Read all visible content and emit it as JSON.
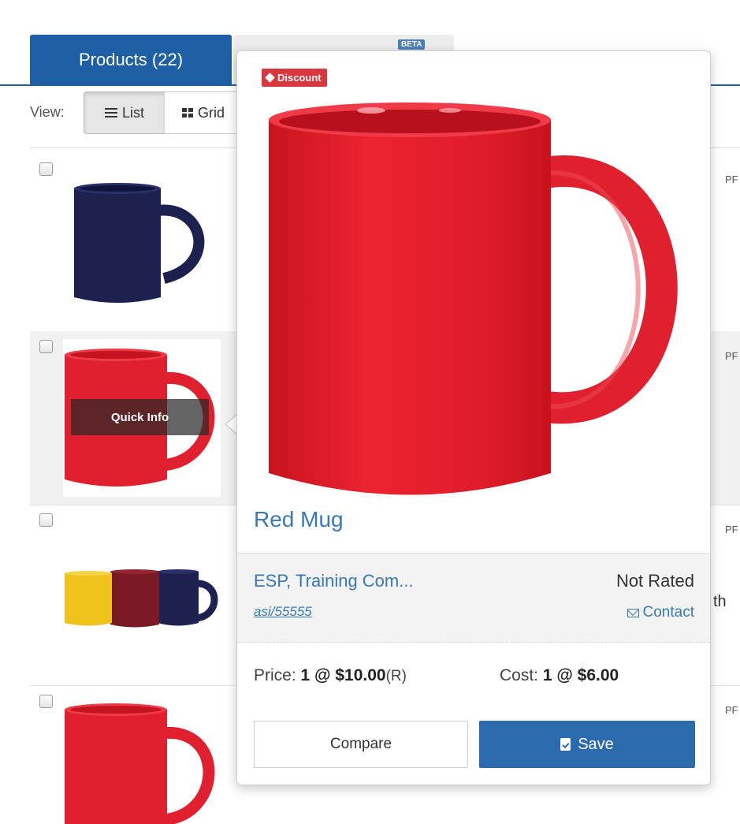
{
  "tabs": {
    "products_label": "Products (22)",
    "beta_badge": "BETA"
  },
  "view": {
    "label": "View:",
    "list_label": "List",
    "grid_label": "Grid"
  },
  "rows": [
    {
      "mug_color": "#1c2150",
      "edge_text": "PF"
    },
    {
      "mug_color": "#e0202e",
      "edge_text": "PF"
    },
    {
      "mug_colors": [
        "#efc21c",
        "#7b1a24",
        "#1c2150"
      ],
      "edge_text": "PF"
    },
    {
      "mug_color": "#e0202e",
      "edge_text": "PF"
    }
  ],
  "row_tail_text": "th",
  "quick_info_label": "Quick Info",
  "popover": {
    "discount_label": "Discount",
    "product_color": "#e0202e",
    "title": "Red Mug",
    "supplier": "ESP, Training Com...",
    "asi": "asi/55555",
    "rating": "Not Rated",
    "contact_label": "Contact",
    "price_label": "Price:",
    "price_value": "1 @ $10.00",
    "price_suffix": "(R)",
    "cost_label": "Cost:",
    "cost_value": "1 @ $6.00",
    "compare_label": "Compare",
    "save_label": "Save"
  },
  "colors": {
    "primary": "#1f5fa5",
    "link": "#3779b8",
    "discount": "#d9363e",
    "save_button": "#2c6aae"
  }
}
